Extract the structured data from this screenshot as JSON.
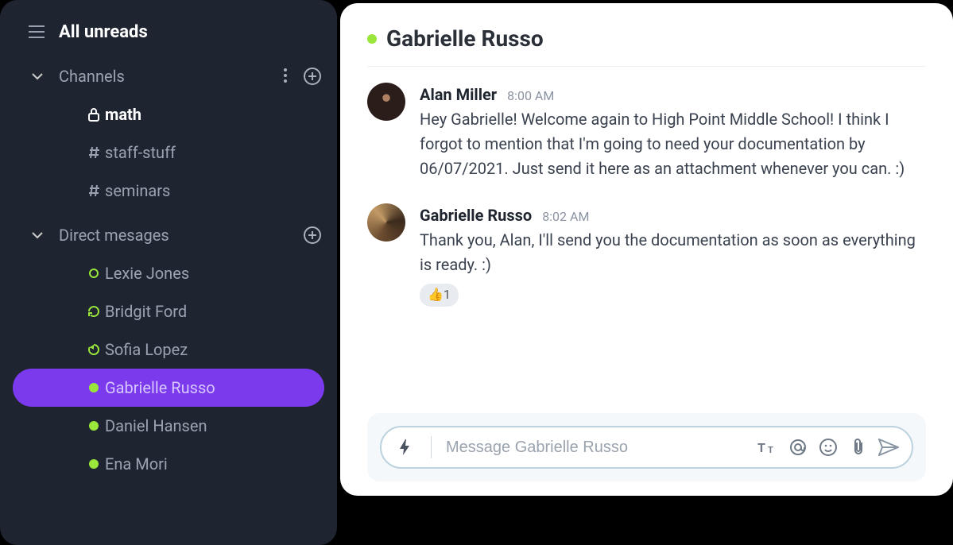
{
  "sidebar": {
    "unreads_label": "All unreads",
    "channels_label": "Channels",
    "dms_label": "Direct mesages",
    "channels": [
      {
        "name": "math",
        "icon": "lock",
        "active": true
      },
      {
        "name": "staff-stuff",
        "icon": "hash",
        "active": false
      },
      {
        "name": "seminars",
        "icon": "hash",
        "active": false
      }
    ],
    "dms": [
      {
        "name": "Lexie Jones",
        "status": "ring",
        "selected": false
      },
      {
        "name": "Bridgit Ford",
        "status": "refresh",
        "selected": false
      },
      {
        "name": "Sofia Lopez",
        "status": "pie",
        "selected": false
      },
      {
        "name": "Gabrielle Russo",
        "status": "online",
        "selected": true
      },
      {
        "name": "Daniel Hansen",
        "status": "online",
        "selected": false
      },
      {
        "name": "Ena Mori",
        "status": "online",
        "selected": false
      }
    ]
  },
  "chat": {
    "header_name": "Gabrielle Russo",
    "messages": [
      {
        "author": "Alan Miller",
        "time": "8:00 AM",
        "text": "Hey Gabrielle! Welcome again to High Point Middle School! I think I forgot to mention that I'm going to need your documentation by 06/07/2021. Just send it here as an attachment whenever you can. :)",
        "avatar": "alan",
        "reaction": null
      },
      {
        "author": "Gabrielle Russo",
        "time": "8:02 AM",
        "text": "Thank you, Alan, I'll send you the documentation as soon as everything is ready. :)",
        "avatar": "gabi",
        "reaction": {
          "emoji": "👍",
          "count": "1"
        }
      }
    ],
    "composer_placeholder": "Message Gabrielle Russo"
  }
}
